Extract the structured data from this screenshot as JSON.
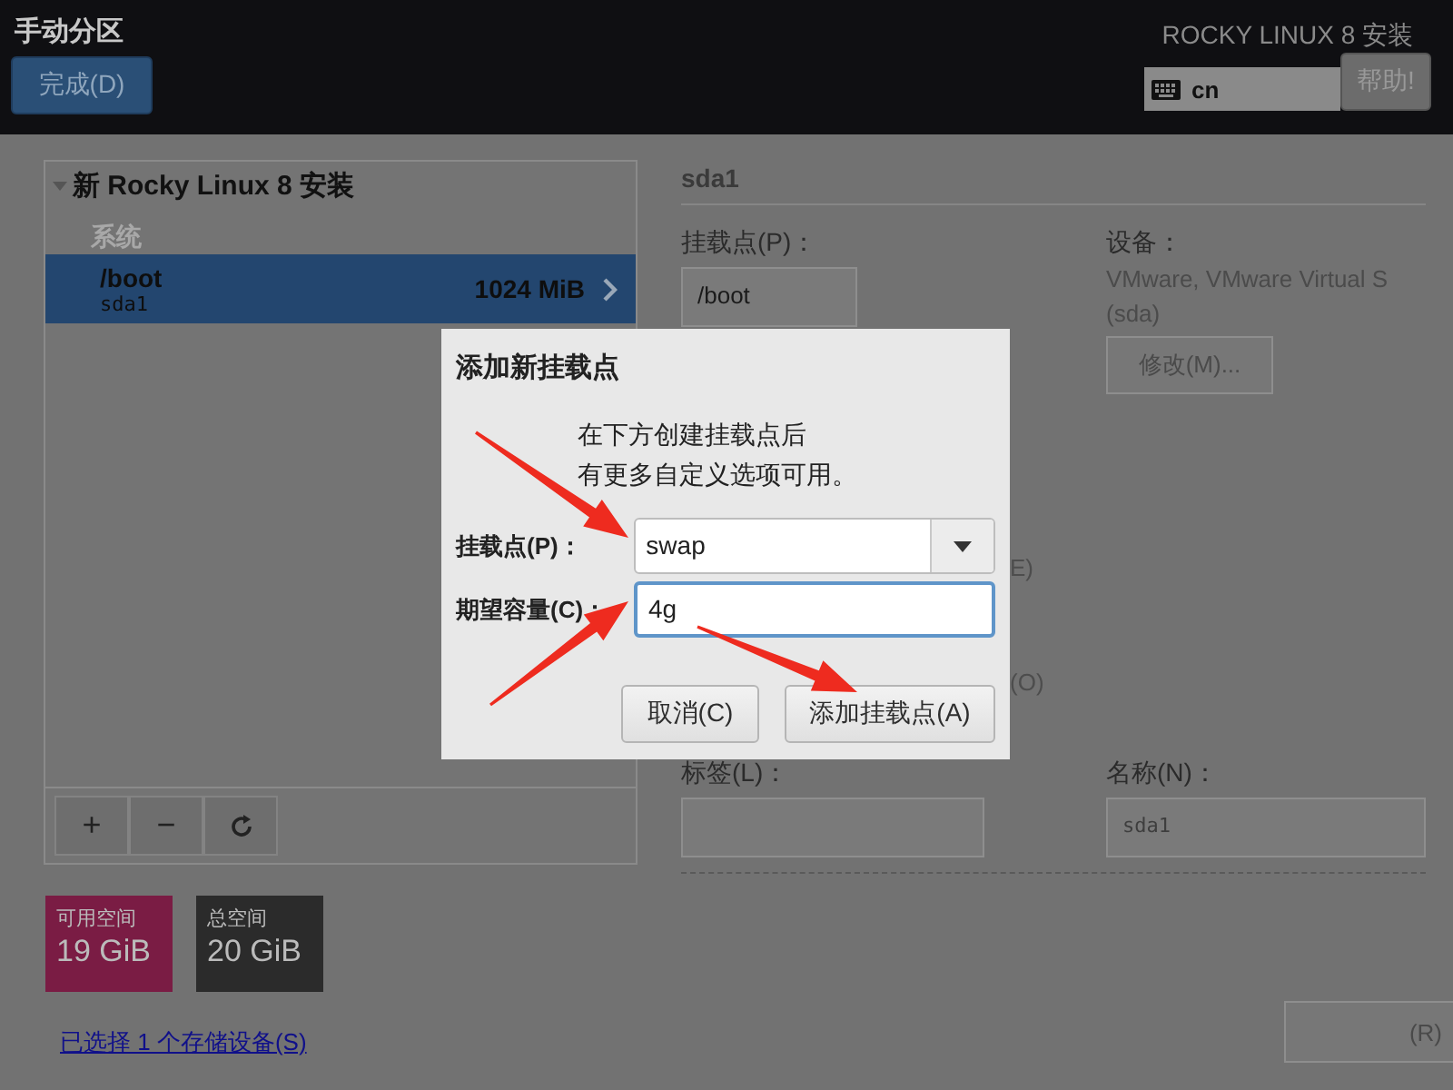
{
  "header": {
    "title": "手动分区",
    "done_button": "完成(D)",
    "product": "ROCKY LINUX 8 安装",
    "keyboard": "cn",
    "help_button": "帮助!"
  },
  "partitions": {
    "title": "新 Rocky Linux 8 安装",
    "expanded": true,
    "sections": [
      {
        "title": "系统",
        "items": [
          {
            "mount": "/boot",
            "device": "sda1",
            "size": "1024 MiB",
            "selected": true
          }
        ]
      }
    ],
    "toolbar": [
      {
        "kind": "text",
        "label": "+"
      },
      {
        "kind": "text",
        "label": "−"
      },
      {
        "kind": "refresh"
      }
    ]
  },
  "space": [
    {
      "label": "可用空间",
      "value": "19 GiB",
      "color": "#7a1c44"
    },
    {
      "label": "总空间",
      "value": "20 GiB",
      "color": "#2b2b2b"
    }
  ],
  "storage_link": "已选择 1 个存储设备(S)",
  "details": {
    "title": "sda1",
    "mount_label": "挂载点(P)：",
    "mount_value": "/boot",
    "device_label": "设备：",
    "device_lines": [
      "VMware, VMware Virtual S",
      "(sda)"
    ],
    "modify_button": "修改(M)...",
    "partial_texts": [
      "E)",
      "(O)"
    ],
    "label_label": "标签(L)：",
    "name_label": "名称(N)：",
    "name_value": "sda1",
    "bottom_button": "(R)"
  },
  "dialog": {
    "title": "添加新挂载点",
    "message": [
      "在下方创建挂载点后",
      "有更多自定义选项可用。"
    ],
    "mount_label": "挂载点(P)：",
    "mount_value": "swap",
    "size_label": "期望容量(C)：",
    "size_value": "4g",
    "buttons": [
      {
        "label": "取消(C)",
        "kind": "cancel"
      },
      {
        "label": "添加挂载点(A)",
        "kind": "confirm"
      }
    ]
  }
}
